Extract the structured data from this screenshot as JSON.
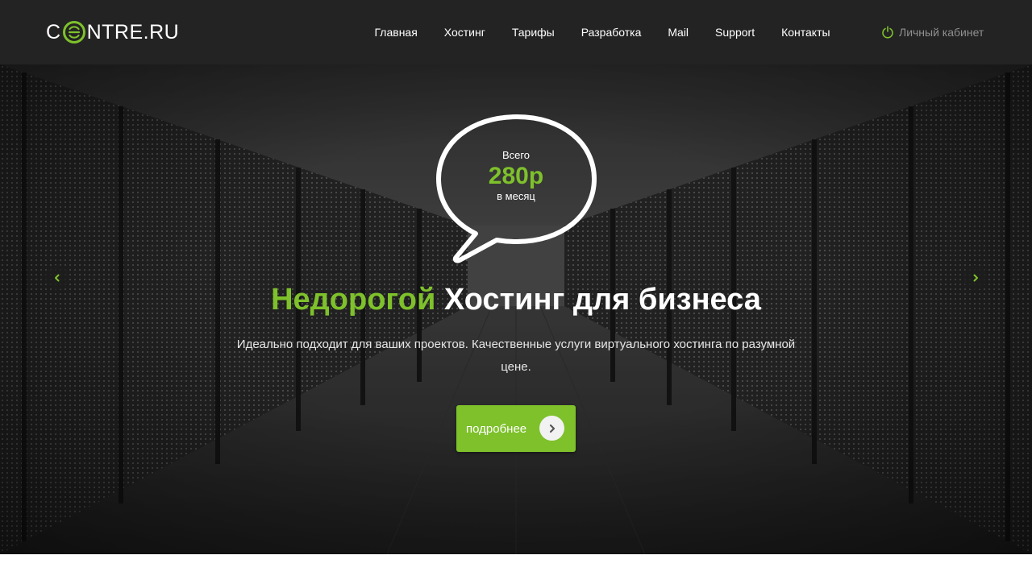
{
  "logo": {
    "text_pre": "C",
    "text_post": "NTRE.RU"
  },
  "nav": {
    "items": [
      {
        "label": "Главная"
      },
      {
        "label": "Хостинг"
      },
      {
        "label": "Тарифы"
      },
      {
        "label": "Разработка"
      },
      {
        "label": "Mail"
      },
      {
        "label": "Support"
      },
      {
        "label": "Контакты"
      }
    ]
  },
  "cabinet": {
    "label": "Личный кабинет",
    "icon": "power-icon"
  },
  "hero": {
    "bubble": {
      "label": "Всего",
      "price": "280р",
      "period": "в месяц"
    },
    "headline_accent": "Недорогой",
    "headline_rest": "Хостинг для бизнеса",
    "subtitle": "Идеально подходит для ваших проектов. Качественные услуги виртуального хостинга по разумной цене.",
    "button_label": "подробнее"
  },
  "colors": {
    "accent": "#7ec12b",
    "header_bg": "#232323",
    "text_light": "#ffffff",
    "muted": "#8f8f8f"
  }
}
